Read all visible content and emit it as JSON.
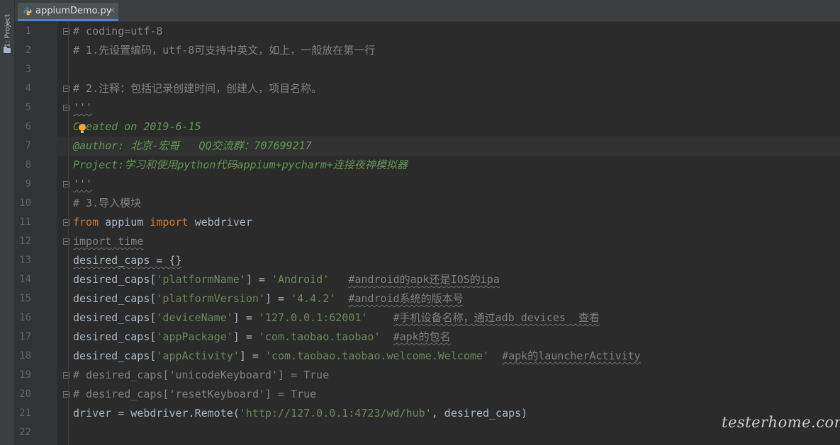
{
  "sidebar": {
    "project_label": "1: Project"
  },
  "tabs": [
    {
      "label": "appiumDemo.py",
      "close": "×"
    }
  ],
  "editor": {
    "line_numbers": [
      "1",
      "2",
      "3",
      "4",
      "5",
      "6",
      "7",
      "8",
      "9",
      "10",
      "11",
      "12",
      "13",
      "14",
      "15",
      "16",
      "17",
      "18",
      "19",
      "20",
      "21",
      "22"
    ],
    "lines": {
      "l1": "# coding=utf-8",
      "l2": "# 1.先设置编码，utf-8可支持中英文，如上，一般放在第一行",
      "l4": "# 2.注释：包括记录创建时间，创建人，项目名称。",
      "l5": "'''",
      "l6": "Created on 2019-6-15",
      "l7": "@author: 北京-宏哥   QQ交流群：707699217",
      "l8": "Project:学习和使用python代码appium+pycharm+连接夜神模拟器",
      "l9": "'''",
      "l10": "# 3.导入模块",
      "l11": {
        "kw1": "from",
        "mod": " appium ",
        "kw2": "import",
        "name": " webdriver"
      },
      "l12": {
        "kw": "import",
        "name": " time"
      },
      "l13": "desired_caps = {}",
      "l14": {
        "a": "desired_caps[",
        "key": "'platformName'",
        "b": "] = ",
        "val": "'Android'",
        "c": "   ",
        "comment": "#android的apk还是IOS的ipa"
      },
      "l15": {
        "a": "desired_caps[",
        "key": "'platformVersion'",
        "b": "] = ",
        "val": "'4.4.2'",
        "c": "  ",
        "comment": "#android系统的版本号"
      },
      "l16": {
        "a": "desired_caps[",
        "key": "'deviceName'",
        "b": "] = ",
        "val": "'127.0.0.1:62001'",
        "c": "    ",
        "comment": "#手机设备名称，通过adb devices  查看"
      },
      "l17": {
        "a": "desired_caps[",
        "key": "'appPackage'",
        "b": "] = ",
        "val": "'com.taobao.taobao'",
        "c": "  ",
        "comment": "#apk的包名"
      },
      "l18": {
        "a": "desired_caps[",
        "key": "'appActivity'",
        "b": "] = ",
        "val": "'com.taobao.taobao.welcome.Welcome'",
        "c": "  ",
        "comment": "#apk的launcherActivity"
      },
      "l19": "# desired_caps['unicodeKeyboard'] = True",
      "l20": "# desired_caps['resetKeyboard'] = True",
      "l21": {
        "a": "driver = webdriver.Remote(",
        "str": "'http://127.0.0.1:4723/wd/hub'",
        "b": ", desired_caps)"
      }
    }
  },
  "watermark": "testerhome.com",
  "colors": {
    "background": "#2b2b2b",
    "gutter": "#313335",
    "keyword": "#cc7832",
    "string": "#6a8759",
    "comment": "#808080",
    "docstring": "#629755",
    "text": "#a9b7c6"
  }
}
